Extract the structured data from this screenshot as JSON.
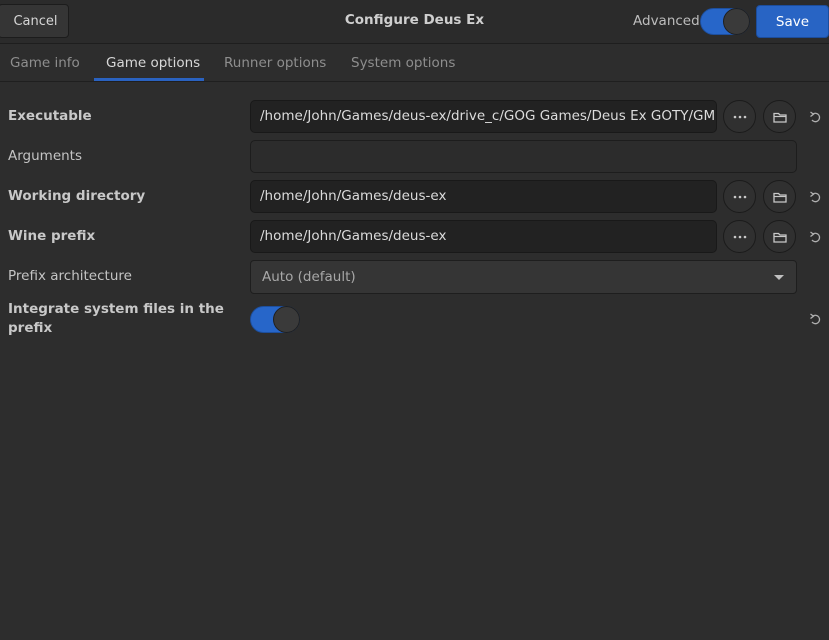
{
  "header": {
    "cancel_label": "Cancel",
    "title": "Configure Deus Ex",
    "advanced_label": "Advanced",
    "advanced_enabled": true,
    "save_label": "Save"
  },
  "tabs": [
    {
      "label": "Game info",
      "active": false
    },
    {
      "label": "Game options",
      "active": true
    },
    {
      "label": "Runner options",
      "active": false
    },
    {
      "label": "System options",
      "active": false
    }
  ],
  "options": {
    "executable": {
      "label": "Executable",
      "value": "/home/John/Games/deus-ex/drive_c/GOG Games/Deus Ex GOTY/GMDXv"
    },
    "arguments": {
      "label": "Arguments",
      "value": ""
    },
    "working_directory": {
      "label": "Working directory",
      "value": "/home/John/Games/deus-ex"
    },
    "wine_prefix": {
      "label": "Wine prefix",
      "value": "/home/John/Games/deus-ex"
    },
    "prefix_architecture": {
      "label": "Prefix architecture",
      "value": "Auto (default)"
    },
    "integrate_system_files": {
      "label": "Integrate system files in the prefix",
      "enabled": true
    }
  },
  "colors": {
    "accent": "#2864c4",
    "background": "#2d2d2d"
  },
  "icons": {
    "more": "ellipsis-icon",
    "folder": "folder-icon",
    "reset": "reset-icon",
    "dropdown": "chevron-down-icon"
  }
}
